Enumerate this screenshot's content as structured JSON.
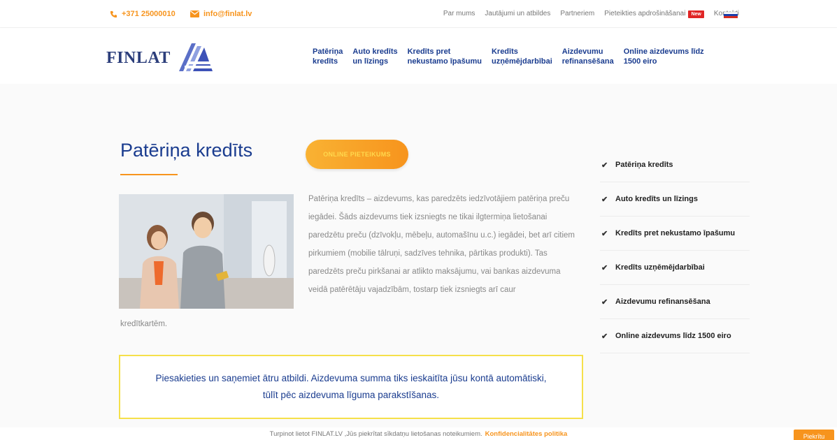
{
  "topbar": {
    "phone": "+371 25000010",
    "email": "info@finlat.lv",
    "links": [
      "Par mums",
      "Jautājumi un atbildes",
      "Partneriem",
      "Pieteikties apdrošināšanai",
      "Kontakti"
    ],
    "badge": "New"
  },
  "header": {
    "logo": "FINLAT",
    "nav": [
      "Patēriņa\nkredīts",
      "Auto kredīts\nun līzings",
      "Kredīts pret\nnekustamo īpašumu",
      "Kredīts\nuzņēmējdarbībai",
      "Aizdevumu\nrefinansēšana",
      "Online aizdevums līdz\n1500 eiro"
    ]
  },
  "main": {
    "title": "Patēriņa kredīts",
    "cta": "ONLINE PIETEIKUMS",
    "paragraph": "Patēriņa kredīts – aizdevums, kas paredzēts iedzīvotājiem patēriņa preču iegādei. Šāds aizdevums tiek izsniegts ne tikai ilgtermiņa lietošanai paredzētu preču (dzīvokļu, mēbeļu, automašīnu u.c.) iegādei, bet arī citiem pirkumiem (mobilie tālruņi, sadzīves tehnika, pārtikas produkti). Tas paredzēts preču pirkšanai ar atlikto maksājumu, vai bankas aizdevuma veidā patērētāju vajadzībām, tostarp tiek izsniegts arī caur",
    "paragraph_tail": "kredītkartēm.",
    "callout": "Piesakieties un saņemiet ātru atbildi. Aizdevuma summa tiks ieskaitīta jūsu kontā automātiski, tūlīt pēc aizdevuma līguma parakstīšanas."
  },
  "sidebar": {
    "items": [
      "Patēriņa kredīts",
      "Auto kredīts un līzings",
      "Kredīts pret nekustamo īpašumu",
      "Kredīts uzņēmējdarbībai",
      "Aizdevumu refinansēšana",
      "Online aizdevums līdz 1500 eiro"
    ]
  },
  "cookie": {
    "text": "Turpinot lietot FINLAT.LV ,Jūs piekrītat sīkdatņu lietošanas noteikumiem.",
    "link": "Konfidencialitātes politika",
    "button": "Piekrītu"
  },
  "colors": {
    "accent": "#f7941d",
    "brand": "#1a3c8f",
    "callout_border": "#f5e04a"
  }
}
